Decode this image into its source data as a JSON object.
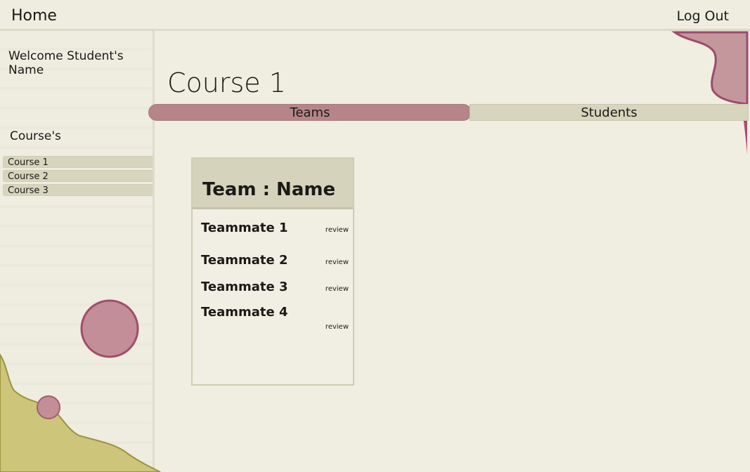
{
  "header": {
    "home_label": "Home",
    "logout_label": "Log Out"
  },
  "sidebar": {
    "welcome_text": "Welcome Student's Name",
    "courses_heading": "Course's",
    "courses": [
      {
        "label": "Course 1"
      },
      {
        "label": "Course 2"
      },
      {
        "label": "Course 3"
      }
    ]
  },
  "main": {
    "title": "Course 1",
    "tabs": [
      {
        "label": "Teams",
        "active": true
      },
      {
        "label": "Students",
        "active": false
      }
    ],
    "team_card": {
      "title": "Team : Name",
      "teammates": [
        {
          "name": "Teammate 1",
          "action": "review"
        },
        {
          "name": "Teammate 2",
          "action": "review"
        },
        {
          "name": "Teammate 3",
          "action": "review"
        },
        {
          "name": "Teammate 4",
          "action": "review"
        }
      ]
    }
  },
  "colors": {
    "background": "#f0eee1",
    "accent_pink": "#b5858a",
    "accent_olive": "#d7d5bd",
    "decor_yellow": "#ccc57a",
    "decor_circle": "#c48e98"
  }
}
